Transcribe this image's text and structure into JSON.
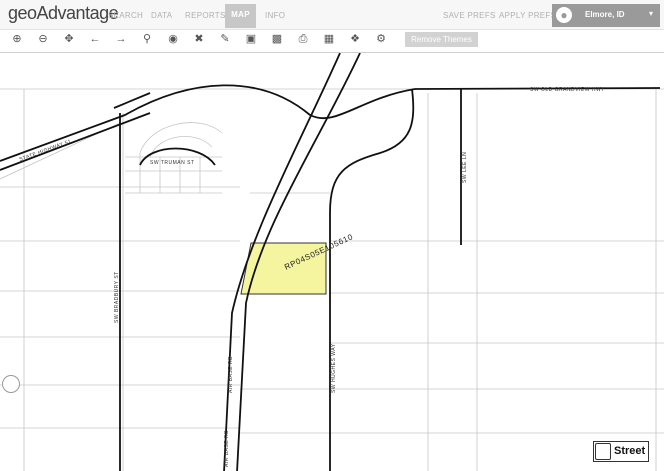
{
  "app": {
    "brand": "geoAdvantage"
  },
  "nav": {
    "search": "SEARCH",
    "data": "DATA",
    "reports": "REPORTS",
    "map": "MAP",
    "info": "INFO",
    "save_prefs": "SAVE PREFS",
    "apply_prefs": "APPLY PREFS",
    "location": "Elmore, ID",
    "location_icon": "globe-icon"
  },
  "toolbar": {
    "tools": [
      "zoom-in-icon",
      "zoom-out-icon",
      "pan-icon",
      "back-icon",
      "forward-icon",
      "search-icon",
      "globe-icon",
      "clear-icon",
      "draw-icon",
      "layers-icon",
      "save-icon",
      "print-icon",
      "toolbox-icon",
      "help-icon",
      "settings-icon"
    ],
    "remove_themes": "Remove Themes"
  },
  "map": {
    "parcel_id": "RP04S05E105610",
    "parcel_color": "#f5f5a0",
    "roads": {
      "old_grandview": "SW OLD GRANDVIEW HWY",
      "state_highway": "STATE HIGHWAY 51",
      "truman": "SW TRUMAN ST",
      "bradbury": "SW BRADBURY ST",
      "air_base_1": "AIR BASE RD",
      "air_base_2": "AIR BASE RD",
      "hughes": "SW HUGHES WAY",
      "lee": "SW LEE LN"
    },
    "basemap_toggle": "Street"
  }
}
